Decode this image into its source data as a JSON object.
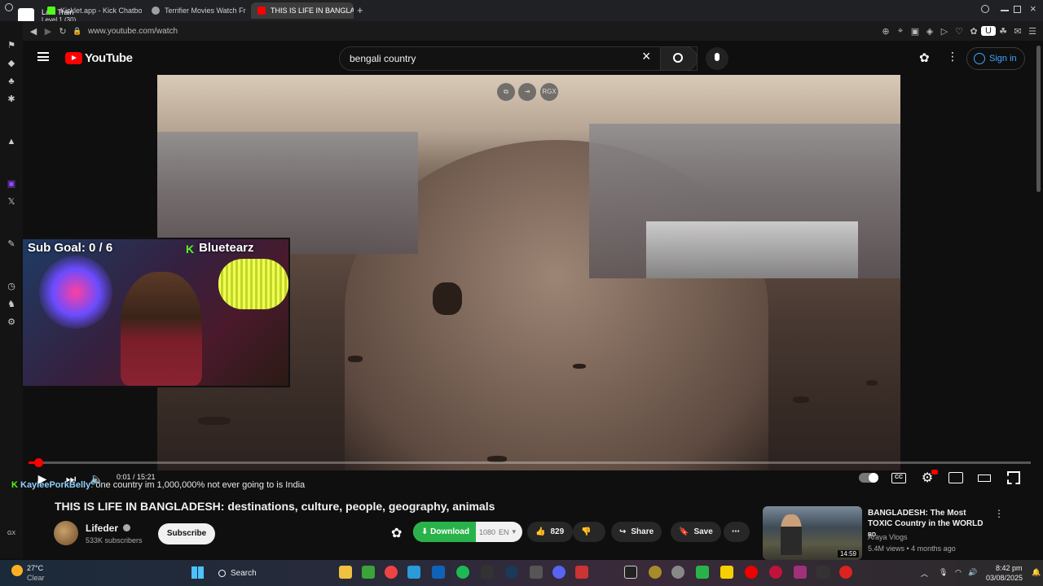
{
  "browser": {
    "profile_label": "Last Train",
    "profile_sub": "Level 1  (30)",
    "tabs": [
      {
        "label": "Kicklet.app - Kick Chatbo",
        "color": "#53fc18"
      },
      {
        "label": "Terrifier Movies Watch Fr",
        "color": "#9aa0a6"
      },
      {
        "label": "THIS IS LIFE IN BANGLAD",
        "color": "#ff0000",
        "active": true
      }
    ],
    "url": "www.youtube.com/watch"
  },
  "youtube": {
    "logo_text": "YouTube",
    "search_value": "bengali country",
    "sign_in": "Sign in"
  },
  "video": {
    "overlay_badge": "RGX",
    "progress_fraction": 0.0011,
    "time": "0:01 / 15:21",
    "title": "THIS IS LIFE IN BANGLADESH: destinations, culture, people, geography, animals"
  },
  "webcam": {
    "sub_goal": "Sub Goal:  0 / 6",
    "streamer": "Bluetearz"
  },
  "chat": {
    "user": "KayleePorkBelly",
    "message": ": one country im 1,000,000% not ever going to is India"
  },
  "channel": {
    "name": "Lifeder",
    "subscribers": "533K subscribers",
    "subscribe_label": "Subscribe"
  },
  "actions": {
    "download": "Download",
    "quality": "1080",
    "lang": "EN",
    "likes": "829",
    "share": "Share",
    "save": "Save"
  },
  "recommendation": {
    "title": "BANGLADESH: The Most TOXIC Country in the WORLD",
    "title_badge": "BD",
    "channel": "Araya Vlogs",
    "meta": "5.4M views • 4 months ago",
    "duration": "14:59"
  },
  "taskbar": {
    "weather_temp": "27°C",
    "weather_desc": "Clear",
    "search": "Search",
    "time": "8:42 pm",
    "date": "03/08/2025"
  },
  "icons": [
    "menu-icon",
    "search-icon",
    "mic-icon",
    "settings-icon",
    "more-icon",
    "play-icon",
    "next-icon",
    "volume-icon",
    "captions-icon",
    "miniplayer-icon",
    "theater-icon",
    "fullscreen-icon",
    "like-icon",
    "dislike-icon",
    "share-icon",
    "save-icon",
    "windows-icon"
  ]
}
